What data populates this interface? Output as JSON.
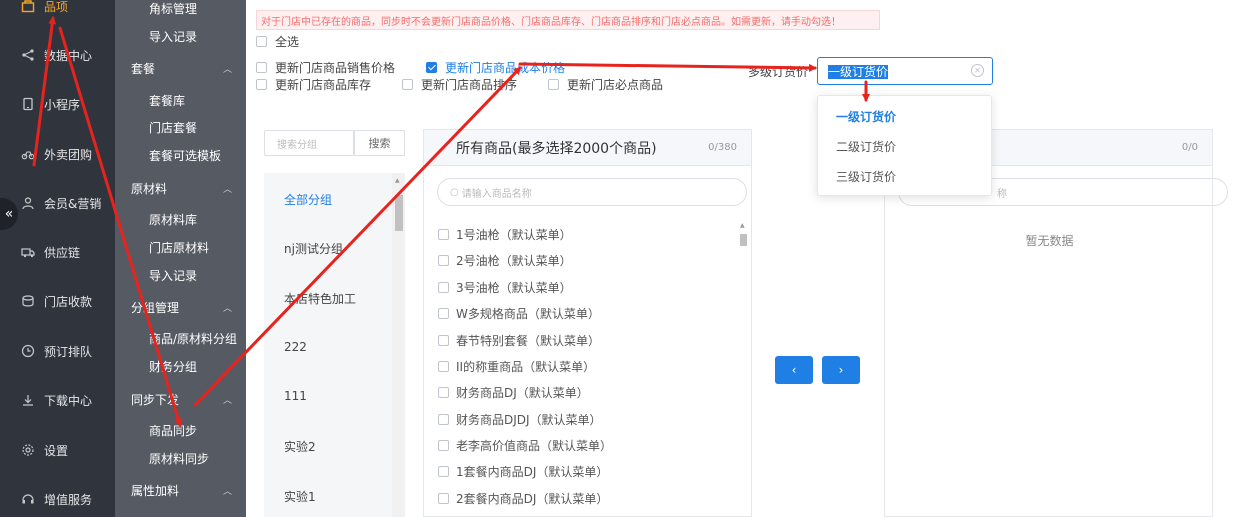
{
  "primary_nav": [
    {
      "label": "品项",
      "icon": "box-icon",
      "active": true
    },
    {
      "label": "数据中心",
      "icon": "share-icon"
    },
    {
      "label": "小程序",
      "icon": "phone-icon"
    },
    {
      "label": "外卖团购",
      "icon": "bike-icon"
    },
    {
      "label": "会员&营销",
      "icon": "user-icon"
    },
    {
      "label": "供应链",
      "icon": "truck-icon"
    },
    {
      "label": "门店收款",
      "icon": "coins-icon"
    },
    {
      "label": "预订排队",
      "icon": "clock-icon"
    },
    {
      "label": "下载中心",
      "icon": "download-icon"
    },
    {
      "label": "设置",
      "icon": "gear-icon"
    },
    {
      "label": "增值服务",
      "icon": "service-icon"
    }
  ],
  "collapse_glyph": "«",
  "secondary_nav": [
    {
      "type": "sub",
      "label": "角标管理"
    },
    {
      "type": "sub",
      "label": "导入记录"
    },
    {
      "type": "group",
      "label": "套餐"
    },
    {
      "type": "sub",
      "label": "套餐库"
    },
    {
      "type": "sub",
      "label": "门店套餐"
    },
    {
      "type": "sub",
      "label": "套餐可选模板"
    },
    {
      "type": "group",
      "label": "原材料"
    },
    {
      "type": "sub",
      "label": "原材料库"
    },
    {
      "type": "sub",
      "label": "门店原材料"
    },
    {
      "type": "sub",
      "label": "导入记录"
    },
    {
      "type": "group",
      "label": "分组管理"
    },
    {
      "type": "sub",
      "label": "商品/原材料分组"
    },
    {
      "type": "sub",
      "label": "财务分组"
    },
    {
      "type": "group",
      "label": "同步下发"
    },
    {
      "type": "sub",
      "label": "商品同步"
    },
    {
      "type": "sub",
      "label": "原材料同步"
    },
    {
      "type": "group",
      "label": "属性加料"
    }
  ],
  "notice": "对于门店中已存在的商品，同步时不会更新门店商品价格、门店商品库存、门店商品排序和门店必点商品。如需更新，请手动勾选！",
  "options": {
    "select_all": "全选",
    "update_sale_price": "更新门店商品销售价格",
    "update_cost_price": "更新门店商品成本价格",
    "update_stock": "更新门店商品库存",
    "update_sort": "更新门店商品排序",
    "update_required": "更新门店必点商品"
  },
  "price_level": {
    "label": "多级订货价",
    "selected": "一级订货价",
    "options": [
      "一级订货价",
      "二级订货价",
      "三级订货价"
    ]
  },
  "category": {
    "search_placeholder": "搜索分组",
    "search_button": "搜索",
    "items": [
      "全部分组",
      "nj测试分组",
      "本店特色加工",
      "222",
      "111",
      "实验2",
      "实验1"
    ]
  },
  "source_list": {
    "title": "所有商品(最多选择2000个商品)",
    "count": "0/380",
    "search_placeholder": "请输入商品名称",
    "items": [
      "1号油枪（默认菜单）",
      "2号油枪（默认菜单）",
      "3号油枪（默认菜单）",
      "W多规格商品（默认菜单）",
      "春节特别套餐（默认菜单）",
      "II的称重商品（默认菜单）",
      "财务商品DJ（默认菜单）",
      "财务商品DJDJ（默认菜单）",
      "老李高价值商品（默认菜单）",
      "1套餐内商品DJ（默认菜单）",
      "2套餐内商品DJ（默认菜单）"
    ]
  },
  "transfer": {
    "left": "‹",
    "right": "›"
  },
  "target_list": {
    "count": "0/0",
    "search_placeholder": "称",
    "empty_text": "暂无数据"
  },
  "colors": {
    "accent": "#1f7fe5",
    "nav_bg": "#30343d",
    "subnav_bg": "#565a63",
    "active_nav": "#f5a623",
    "annotation": "#e8231e"
  }
}
